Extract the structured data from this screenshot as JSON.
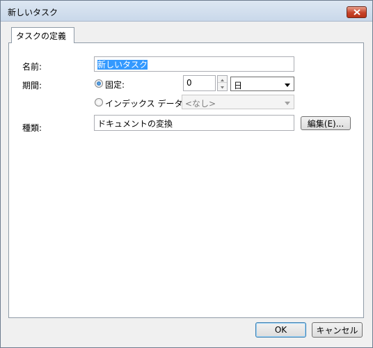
{
  "window": {
    "title": "新しいタスク"
  },
  "tabs": [
    {
      "label": "タスクの定義"
    }
  ],
  "form": {
    "name_label": "名前:",
    "name_value": "新しいタスク",
    "period_label": "期間:",
    "fixed_label": "固定:",
    "fixed_value": "0",
    "unit_value": "日",
    "index_label": "インデックス データ:",
    "index_value": "<なし>",
    "type_label": "種類:",
    "type_value": "ドキュメントの変換",
    "edit_button": "編集(E)..."
  },
  "footer": {
    "ok": "OK",
    "cancel": "キャンセル"
  }
}
